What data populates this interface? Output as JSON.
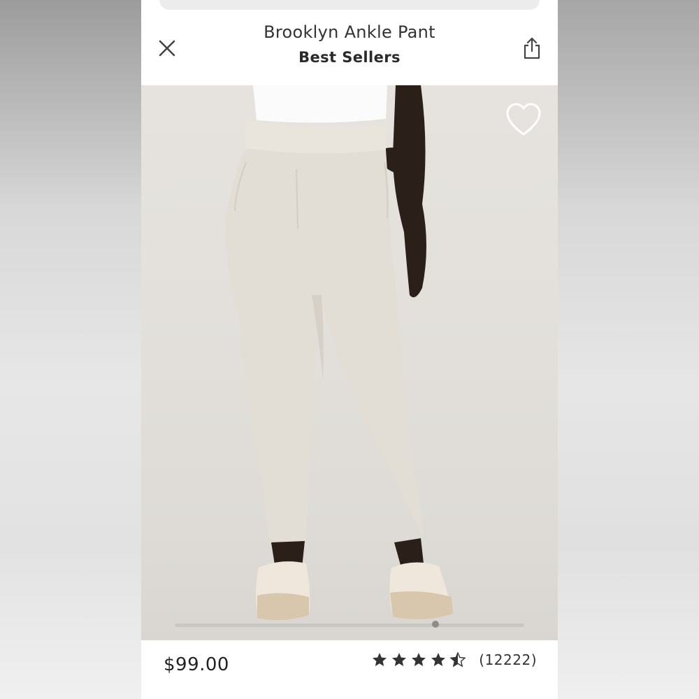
{
  "header": {
    "title": "Brooklyn Ankle Pant",
    "subtitle": "Best Sellers",
    "close_icon": "close-icon",
    "share_icon": "share-icon"
  },
  "image": {
    "favorite_icon": "heart-outline-icon",
    "carousel_position": 0.75
  },
  "footer": {
    "price": "$99.00",
    "rating": 4.5,
    "review_count": "(12222)"
  },
  "colors": {
    "background": "#ffffff",
    "text": "#222222",
    "photo_bg": "#e4e1dc",
    "pant": "#e2ddd4"
  }
}
